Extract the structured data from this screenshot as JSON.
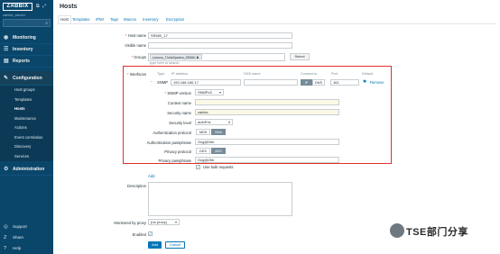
{
  "sidebar": {
    "logo": "ZABBIX",
    "server_name": "zabbix_server",
    "search_placeholder": "",
    "menu": [
      {
        "label": "Monitoring",
        "icon": "eye-icon"
      },
      {
        "label": "Inventory",
        "icon": "list-icon"
      },
      {
        "label": "Reports",
        "icon": "chart-icon"
      },
      {
        "label": "Configuration",
        "icon": "wrench-icon"
      }
    ],
    "submenu": [
      "Host groups",
      "Templates",
      "Hosts",
      "Maintenance",
      "Actions",
      "Event correlation",
      "Discovery",
      "Services"
    ],
    "active_submenu": "Hosts",
    "admin": "Administration",
    "bottom": [
      "Support",
      "Share",
      "Help"
    ]
  },
  "page": {
    "title": "Hosts",
    "tabs": [
      "Host",
      "Templates",
      "IPMI",
      "Tags",
      "Macros",
      "Inventory",
      "Encryption"
    ],
    "active_tab": "Host"
  },
  "form": {
    "host_name_label": "Host name",
    "host_name_value": "SR650_17",
    "visible_name_label": "Visible name",
    "visible_name_value": "",
    "groups_label": "Groups",
    "group_chip": "Lenovo_ThinkSystem_SR650",
    "groups_hint": "type here to search",
    "select_button": "Select",
    "interfaces_label": "Interfaces",
    "col_type": "Type",
    "col_ip": "IP address",
    "col_dns": "DNS name",
    "col_connect": "Connect to",
    "col_port": "Port",
    "col_default": "Default",
    "snmp_type": "SNMP",
    "ip_value": "192.168.180.17",
    "dns_value": "",
    "connect_ip": "IP",
    "connect_dns": "DNS",
    "port_value": "161",
    "remove_link": "Remove",
    "snmp_version_label": "SNMP version",
    "snmp_version_value": "SNMPv3",
    "context_name_label": "Context name",
    "context_name_value": "",
    "security_name_label": "Security name",
    "security_name_value": "zabbix",
    "security_level_label": "Security level",
    "security_level_value": "authPriv",
    "auth_protocol_label": "Authentication protocol",
    "auth_md5": "MD5",
    "auth_sha": "SHA",
    "auth_pass_label": "Authentication passphrase",
    "auth_pass_value": "Gcg@Zbb",
    "privacy_protocol_label": "Privacy protocol",
    "priv_des": "DES",
    "priv_aes": "AES",
    "privacy_pass_label": "Privacy passphrase",
    "privacy_pass_value": "Gcg@Zbb",
    "bulk_label": "Use bulk requests",
    "add_link": "Add",
    "description_label": "Description",
    "description_value": "",
    "proxy_label": "Monitored by proxy",
    "proxy_value": "(no proxy)",
    "enabled_label": "Enabled",
    "add_button": "Add",
    "cancel_button": "Cancel"
  },
  "watermark": "TSE部门分享",
  "colors": {
    "sidebar": "#0a466a",
    "accent": "#0275b8",
    "highlight_box": "#e0312f"
  }
}
